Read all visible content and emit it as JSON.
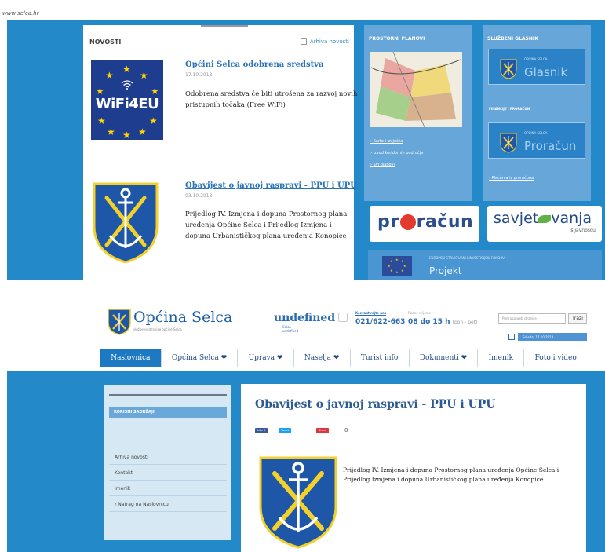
{
  "url_text": "www.selca.hr",
  "top": {
    "news": {
      "heading": "NOVOSTI",
      "archive_label": "Arhiva novosti",
      "articles": [
        {
          "title": "Općini Selca odobrena sredstva",
          "date": "17.10.2018.",
          "body": "Odobrena sredstva će biti utrošena za razvoj novih pristupnih točaka (Free WiFi)",
          "thumb_text": "WiFi4EU"
        },
        {
          "title": "Obavijest o javnoj raspravi - PPU i UPU",
          "date": "03.10.2018.",
          "body": "Prijedlog IV. Izmjena i dopuna Prostornog plana uređenja Općine Selca i Prijedlog Izmjena i dopuna Urbanističkog plana uređenja Konopice"
        }
      ]
    },
    "plans_panel": {
      "heading": "PROSTORNI PLANOVI",
      "links": [
        "Karte i izvješća",
        "Izvod koridornih područja",
        "Svi planovi"
      ]
    },
    "glasnik_panel": {
      "heading": "SLUŽBENI GLASNIK",
      "badge_small": "OPĆINA SELCA",
      "badge_big": "Glasnik",
      "finance_heading": "FINANCIJE I PRORAČUN",
      "finance_small": "OPĆINA SELCA",
      "finance_big": "Proračun",
      "finance_link": "Plaćanja iz proračuna"
    },
    "proracun_logo": {
      "pre": "pr",
      "post": "račun"
    },
    "savjet_logo": {
      "pre": "savjet",
      "post": "vanja",
      "sub": "s javnošću"
    },
    "projekt": {
      "small": "EUROPSKI STRUKTURNI I INVESTICIJSKI FONDOVI",
      "big": "Projekt"
    }
  },
  "bottom": {
    "site_name": "Općina Selca",
    "site_slogan": "službene stranice općine Selca",
    "undefined_text": "undefined",
    "undefined_sub": [
      "Selca",
      "undefined"
    ],
    "phone_label": "Kontaktirajte nas",
    "phone_number": "021/622-663",
    "hours_label": "Radno vrijeme",
    "hours_value": "08 do 15 h",
    "hours_suffix": "(pon - pet)",
    "search_placeholder": "Pretraga web stranice",
    "search_button": "Traži",
    "date_text": "Srijeda, 17.10.2018.",
    "menu": [
      "Naslovnica",
      "Općina Selca ❤",
      "Uprava ❤",
      "Naselja ❤",
      "Turist info",
      "Dokumenti ❤",
      "Imenik",
      "Foto i video"
    ],
    "side_heading": "KORISNI SADRŽAJI",
    "side_items": [
      "Arhiva novosti",
      "Kontakt",
      "Imenik",
      "‹ Natrag na Naslovnicu"
    ],
    "content_title": "Obavijest o javnoj raspravi - PPU i UPU",
    "share": {
      "like": "Like 0",
      "tweet": "Tweet",
      "share": "Share",
      "count": "0"
    },
    "content_body": "Prijedlog IV. Izmjena i dopuna Prostornog plana uređenja Općine Selca i Prijedlog Izmjena i dopuna Urbanističkog plana uređenja Konopice"
  },
  "colors": {
    "brand_blue": "#2489c8",
    "link_blue": "#2a73b8",
    "panel_blue": "#66a6d8",
    "coat_yellow": "#f4d12a",
    "coat_blue": "#1e56a8"
  }
}
